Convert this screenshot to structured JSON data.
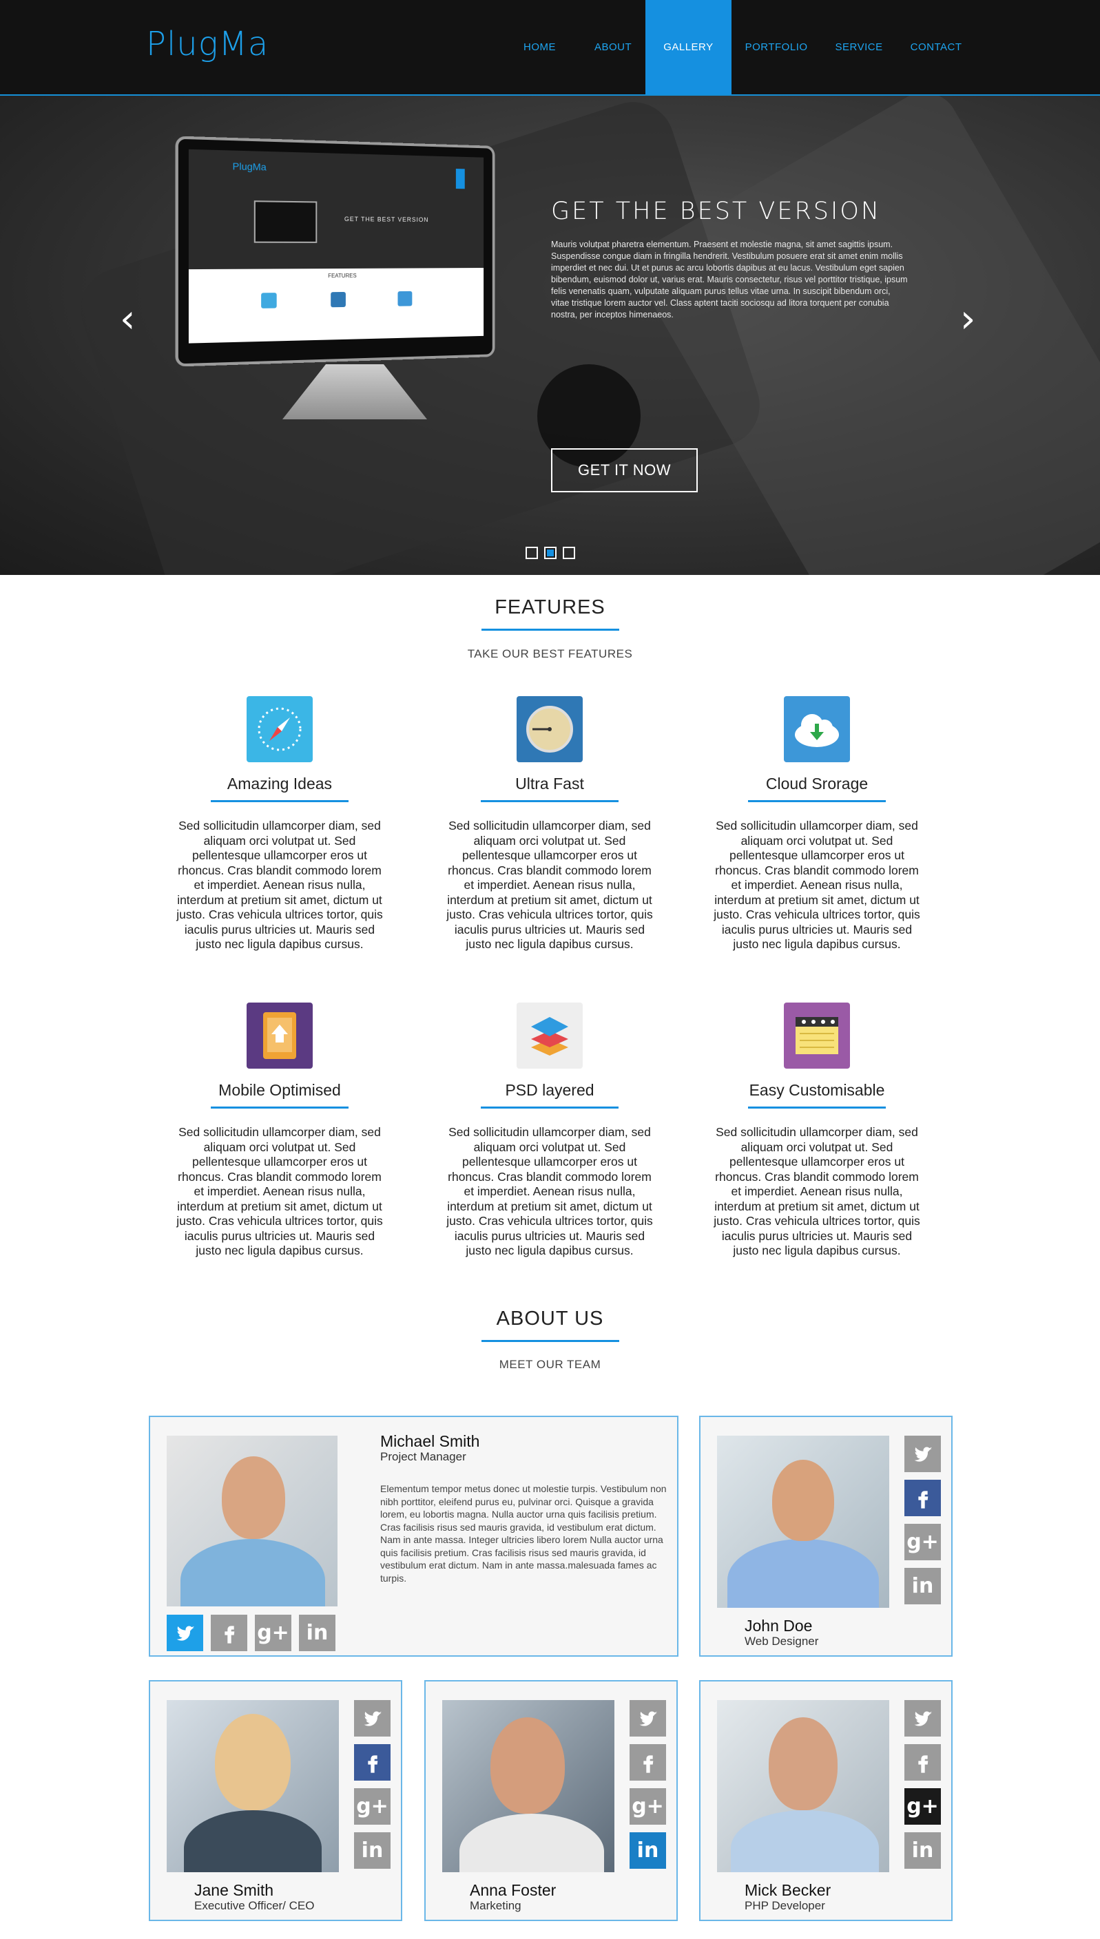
{
  "header": {
    "logo": "PlugMa",
    "nav": [
      "HOME",
      "ABOUT",
      "GALLERY",
      "PORTFOLIO",
      "SERVICE",
      "CONTACT"
    ],
    "active_nav": "GALLERY"
  },
  "hero": {
    "title": "GET THE BEST VERSION",
    "paragraph": "Mauris volutpat pharetra elementum. Praesent et molestie magna, sit amet sagittis ipsum. Suspendisse congue diam in fringilla hendrerit. Vestibulum posuere erat sit amet enim mollis imperdiet et nec dui. Ut et purus ac arcu lobortis dapibus at eu lacus. Vestibulum eget sapien bibendum, euismod dolor ut, varius erat. Mauris consectetur, risus vel porttitor tristique, ipsum felis venenatis quam, vulputate aliquam purus tellus vitae urna. In suscipit bibendum orci, vitae tristique lorem auctor vel. Class aptent taciti sociosqu ad litora torquent per conubia nostra, per inceptos himenaeos.",
    "button": "GET IT NOW",
    "slides_count": 3,
    "active_slide": 2,
    "screen_mock": {
      "logo": "PlugMa",
      "title": "GET THE BEST VERSION",
      "features_label": "FEATURES"
    }
  },
  "features": {
    "title": "FEATURES",
    "subtitle": "TAKE OUR BEST FEATURES",
    "items": [
      {
        "title": "Amazing Ideas",
        "icon": "compass-icon",
        "color": "#3bb6e6",
        "text": "Sed sollicitudin ullamcorper diam, sed aliquam orci volutpat ut. Sed pellentesque ullamcorper eros ut rhoncus. Cras blandit commodo lorem et imperdiet. Aenean risus nulla, interdum at pretium sit amet, dictum ut justo. Cras vehicula ultrices tortor, quis iaculis purus ultricies ut. Mauris sed justo nec ligula dapibus cursus."
      },
      {
        "title": "Ultra Fast",
        "icon": "clock-icon",
        "color": "#2f78b5",
        "text": "Sed sollicitudin ullamcorper diam, sed aliquam orci volutpat ut. Sed pellentesque ullamcorper eros ut rhoncus. Cras blandit commodo lorem et imperdiet. Aenean risus nulla, interdum at pretium sit amet, dictum ut justo. Cras vehicula ultrices tortor, quis iaculis purus ultricies ut. Mauris sed justo nec ligula dapibus cursus."
      },
      {
        "title": "Cloud Srorage",
        "icon": "cloud-download-icon",
        "color": "#3d97d8",
        "text": "Sed sollicitudin ullamcorper diam, sed aliquam orci volutpat ut. Sed pellentesque ullamcorper eros ut rhoncus. Cras blandit commodo lorem et imperdiet. Aenean risus nulla, interdum at pretium sit amet, dictum ut justo. Cras vehicula ultrices tortor, quis iaculis purus ultricies ut. Mauris sed justo nec ligula dapibus cursus."
      },
      {
        "title": "Mobile Optimised",
        "icon": "mobile-upload-icon",
        "color": "#5b3a82",
        "text": "Sed sollicitudin ullamcorper diam, sed aliquam orci volutpat ut. Sed pellentesque ullamcorper eros ut rhoncus. Cras blandit commodo lorem et imperdiet. Aenean risus nulla, interdum at pretium sit amet, dictum ut justo. Cras vehicula ultrices tortor, quis iaculis purus ultricies ut. Mauris sed justo nec ligula dapibus cursus."
      },
      {
        "title": "PSD layered",
        "icon": "layers-icon",
        "color": "#eeeeee",
        "text": "Sed sollicitudin ullamcorper diam, sed aliquam orci volutpat ut. Sed pellentesque ullamcorper eros ut rhoncus. Cras blandit commodo lorem et imperdiet. Aenean risus nulla, interdum at pretium sit amet, dictum ut justo. Cras vehicula ultrices tortor, quis iaculis purus ultricies ut. Mauris sed justo nec ligula dapibus cursus."
      },
      {
        "title": "Easy Customisable",
        "icon": "notepad-icon",
        "color": "#9a5aa6",
        "text": "Sed sollicitudin ullamcorper diam, sed aliquam orci volutpat ut. Sed pellentesque ullamcorper eros ut rhoncus. Cras blandit commodo lorem et imperdiet. Aenean risus nulla, interdum at pretium sit amet, dictum ut justo. Cras vehicula ultrices tortor, quis iaculis purus ultricies ut. Mauris sed justo nec ligula dapibus cursus."
      }
    ]
  },
  "about": {
    "title": "ABOUT US",
    "subtitle": "MEET OUR TEAM",
    "social_glyphs": {
      "googleplus": "g+",
      "linkedin": "in"
    },
    "members": [
      {
        "name": "Michael Smith",
        "role": "Project Manager",
        "bio": "Elementum tempor metus donec ut molestie turpis. Vestibulum non nibh porttitor, eleifend purus eu, pulvinar orci. Quisque a gravida lorem, eu lobortis magna. Nulla auctor urna quis facilisis pretium. Cras facilisis risus sed mauris gravida, id vestibulum erat dictum. Nam in ante massa. Integer ultricies libero lorem Nulla auctor urna quis facilisis pretium. Cras facilisis risus sed mauris gravida, id vestibulum erat dictum. Nam in ante massa.malesuada fames ac turpis.",
        "active_social": "twitter"
      },
      {
        "name": "John Doe",
        "role": "Web Designer",
        "active_social": "facebook"
      },
      {
        "name": "Jane Smith",
        "role": "Executive Officer/ CEO",
        "active_social": "facebook"
      },
      {
        "name": "Anna Foster",
        "role": "Marketing",
        "active_social": "linkedin"
      },
      {
        "name": "Mick Becker",
        "role": "PHP Developer",
        "active_social": "googleplus"
      }
    ]
  },
  "colors": {
    "accent": "#1590e0",
    "header_bg": "#121212",
    "card_border": "#6ab7e8",
    "social_inactive": "#9b9b9b"
  }
}
